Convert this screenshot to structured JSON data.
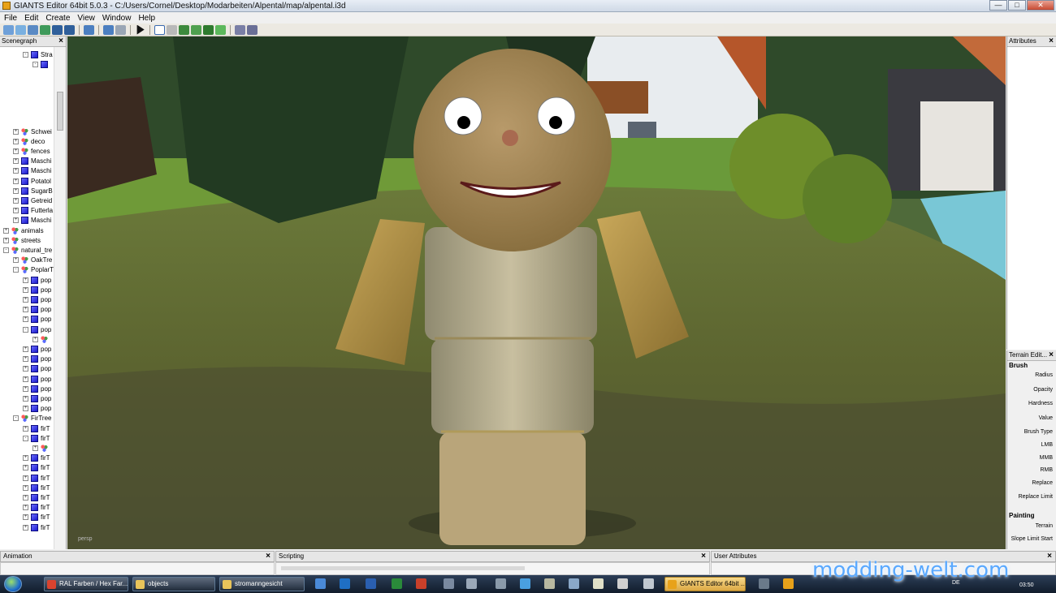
{
  "window": {
    "title": "GIANTS Editor 64bit 5.0.3 - C:/Users/Cornel/Desktop/Modarbeiten/Alpental/map/alpental.i3d"
  },
  "menu": [
    "File",
    "Edit",
    "Create",
    "View",
    "Window",
    "Help"
  ],
  "scenegraph": {
    "title": "Scenegraph",
    "items": [
      {
        "label": "Stra",
        "indent": 2,
        "icon": "cube",
        "exp": "-"
      },
      {
        "label": "",
        "indent": 3,
        "icon": "cube",
        "exp": "-"
      },
      {
        "label": "Schwei",
        "indent": 1,
        "icon": "group",
        "exp": "+"
      },
      {
        "label": "deco",
        "indent": 1,
        "icon": "group",
        "exp": "+"
      },
      {
        "label": "fences",
        "indent": 1,
        "icon": "group",
        "exp": "+"
      },
      {
        "label": "Maschi",
        "indent": 1,
        "icon": "cube",
        "exp": "+"
      },
      {
        "label": "Maschi",
        "indent": 1,
        "icon": "cube",
        "exp": "+"
      },
      {
        "label": "Potatol",
        "indent": 1,
        "icon": "cube",
        "exp": "+"
      },
      {
        "label": "SugarB",
        "indent": 1,
        "icon": "cube",
        "exp": "+"
      },
      {
        "label": "Getreid",
        "indent": 1,
        "icon": "cube",
        "exp": "+"
      },
      {
        "label": "Futterla",
        "indent": 1,
        "icon": "cube",
        "exp": "+"
      },
      {
        "label": "Maschi",
        "indent": 1,
        "icon": "cube",
        "exp": "+"
      },
      {
        "label": "animals",
        "indent": 0,
        "icon": "group",
        "exp": "+"
      },
      {
        "label": "streets",
        "indent": 0,
        "icon": "group",
        "exp": "+"
      },
      {
        "label": "natural_tre",
        "indent": 0,
        "icon": "group",
        "exp": "-"
      },
      {
        "label": "OakTre",
        "indent": 1,
        "icon": "group",
        "exp": "+"
      },
      {
        "label": "PoplarT",
        "indent": 1,
        "icon": "group",
        "exp": "-"
      },
      {
        "label": "pop",
        "indent": 2,
        "icon": "cube",
        "exp": "+"
      },
      {
        "label": "pop",
        "indent": 2,
        "icon": "cube",
        "exp": "+"
      },
      {
        "label": "pop",
        "indent": 2,
        "icon": "cube",
        "exp": "+"
      },
      {
        "label": "pop",
        "indent": 2,
        "icon": "cube",
        "exp": "+"
      },
      {
        "label": "pop",
        "indent": 2,
        "icon": "cube",
        "exp": "+"
      },
      {
        "label": "pop",
        "indent": 2,
        "icon": "cube",
        "exp": "-"
      },
      {
        "label": "",
        "indent": 3,
        "icon": "group",
        "exp": "+"
      },
      {
        "label": "pop",
        "indent": 2,
        "icon": "cube",
        "exp": "+"
      },
      {
        "label": "pop",
        "indent": 2,
        "icon": "cube",
        "exp": "+"
      },
      {
        "label": "pop",
        "indent": 2,
        "icon": "cube",
        "exp": "+"
      },
      {
        "label": "pop",
        "indent": 2,
        "icon": "cube",
        "exp": "+"
      },
      {
        "label": "pop",
        "indent": 2,
        "icon": "cube",
        "exp": "+"
      },
      {
        "label": "pop",
        "indent": 2,
        "icon": "cube",
        "exp": "+"
      },
      {
        "label": "pop",
        "indent": 2,
        "icon": "cube",
        "exp": "+"
      },
      {
        "label": "FirTree",
        "indent": 1,
        "icon": "group",
        "exp": "-"
      },
      {
        "label": "firT",
        "indent": 2,
        "icon": "cube",
        "exp": "+"
      },
      {
        "label": "firT",
        "indent": 2,
        "icon": "cube",
        "exp": "-"
      },
      {
        "label": "",
        "indent": 3,
        "icon": "group",
        "exp": "+"
      },
      {
        "label": "firT",
        "indent": 2,
        "icon": "cube",
        "exp": "+"
      },
      {
        "label": "firT",
        "indent": 2,
        "icon": "cube",
        "exp": "+"
      },
      {
        "label": "firT",
        "indent": 2,
        "icon": "cube",
        "exp": "+"
      },
      {
        "label": "firT",
        "indent": 2,
        "icon": "cube",
        "exp": "+"
      },
      {
        "label": "firT",
        "indent": 2,
        "icon": "cube",
        "exp": "+"
      },
      {
        "label": "firT",
        "indent": 2,
        "icon": "cube",
        "exp": "+"
      },
      {
        "label": "firT",
        "indent": 2,
        "icon": "cube",
        "exp": "+"
      },
      {
        "label": "firT",
        "indent": 2,
        "icon": "cube",
        "exp": "+"
      }
    ]
  },
  "viewport": {
    "camera_label": "persp"
  },
  "attributes": {
    "title": "Attributes"
  },
  "terrain_editor": {
    "title": "Terrain Edit...",
    "brush_section": "Brush",
    "brush_fields": [
      "Radius",
      "Opacity",
      "Hardness",
      "Value",
      "Brush Type",
      "LMB",
      "MMB",
      "RMB",
      "Replace",
      "Replace Limit"
    ],
    "painting_section": "Painting",
    "painting_fields": [
      "Terrain",
      "Slope Limit Start"
    ]
  },
  "docks": {
    "animation": "Animation",
    "scripting": "Scripting",
    "user_attributes": "User Attributes"
  },
  "taskbar": {
    "tasks": [
      "RAL Farben / Hex Far...",
      "objects",
      "stromanngesicht",
      "GIANTS Editor 64bit ..."
    ],
    "lang": "DE",
    "clock": "03:50"
  },
  "watermark": "modding-welt.com"
}
